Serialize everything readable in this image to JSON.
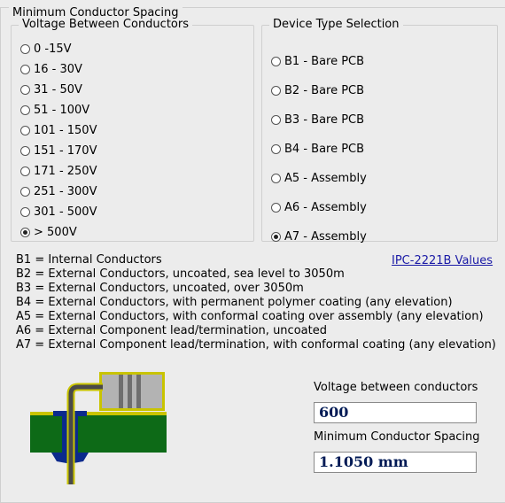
{
  "title": "Minimum Conductor Spacing",
  "voltage_group": {
    "label": "Voltage Between Conductors",
    "options": [
      "0 -15V",
      "16 - 30V",
      "31 - 50V",
      "51 - 100V",
      "101 - 150V",
      "151 - 170V",
      "171 - 250V",
      "251 - 300V",
      "301 - 500V",
      "> 500V"
    ],
    "selected_index": 9
  },
  "device_group": {
    "label": "Device Type Selection",
    "options": [
      "B1 - Bare PCB",
      "B2 - Bare PCB",
      "B3 - Bare PCB",
      "B4 - Bare PCB",
      "A5 - Assembly",
      "A6 - Assembly",
      "A7 - Assembly"
    ],
    "selected_index": 6
  },
  "legend_lines": [
    "B1 = Internal Conductors",
    "B2 = External Conductors, uncoated, sea level to 3050m",
    "B3 = External Conductors, uncoated, over 3050m",
    "B4 = External Conductors, with permanent polymer coating (any elevation)",
    "A5 = External Conductors, with conformal coating over assembly (any elevation)",
    "A6 = External Component lead/termination, uncoated",
    "A7 = External Component lead/termination, with conformal coating (any elevation)"
  ],
  "link_label": "IPC-2221B Values",
  "voltage_field": {
    "label": "Voltage between conductors",
    "value": "600"
  },
  "spacing_field": {
    "label": "Minimum Conductor Spacing",
    "value": "1.1050 mm"
  },
  "colors": {
    "board_green": "#0d6a17",
    "copper_blue": "#0b2a8c",
    "lead_yellow": "#c9c400",
    "component_gray": "#b3b3b3",
    "value_text": "#001a55"
  }
}
